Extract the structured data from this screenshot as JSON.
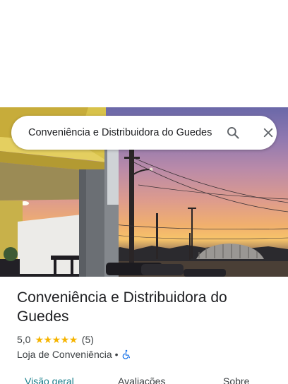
{
  "search": {
    "query": "Conveniência e Distribuidora do Guedes",
    "colors": {
      "background": "#ffffff",
      "text": "#202124",
      "icon": "#5f6368"
    }
  },
  "place": {
    "name": "Conveniência e Distribuidora do Guedes",
    "rating": "5,0",
    "stars": 5,
    "review_count": "(5)",
    "category": "Loja de Conveniência",
    "separator": "•",
    "accessibility_icon": "wheelchair-icon"
  },
  "tabs": [
    {
      "label": "Visão geral",
      "active": true
    },
    {
      "label": "Avaliações",
      "active": false
    },
    {
      "label": "Sobre",
      "active": false
    }
  ],
  "colors": {
    "accent": "#1a7f8c",
    "star": "#f6b400",
    "accessibility": "#1a73e8"
  },
  "icons": [
    "search-icon",
    "close-icon",
    "star-icon",
    "wheelchair-icon"
  ]
}
